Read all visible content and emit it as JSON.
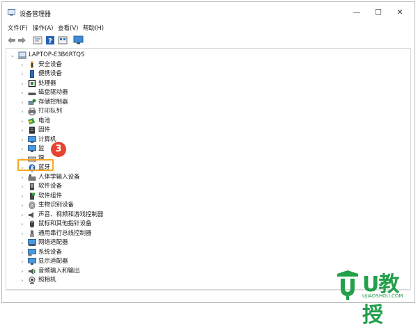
{
  "window": {
    "title": "设备管理器",
    "controls": {
      "minimize": "—",
      "maximize": "☐",
      "close": "✕"
    }
  },
  "menu": [
    {
      "label": "文件(F)"
    },
    {
      "label": "操作(A)"
    },
    {
      "label": "查看(V)"
    },
    {
      "label": "帮助(H)"
    }
  ],
  "toolbar": {
    "icons": [
      "back-arrow-icon",
      "forward-arrow-icon",
      "properties-icon",
      "help-icon",
      "view-icon",
      "monitor-icon"
    ]
  },
  "tree": {
    "root": {
      "label": "LAPTOP-E3B6RTQS",
      "expanded": true
    },
    "items": [
      {
        "label": "安全设备",
        "icon": "security-key-icon"
      },
      {
        "label": "便携设备",
        "icon": "portable-device-icon"
      },
      {
        "label": "处理器",
        "icon": "processor-icon"
      },
      {
        "label": "磁盘驱动器",
        "icon": "disk-drive-icon"
      },
      {
        "label": "存储控制器",
        "icon": "storage-controller-icon"
      },
      {
        "label": "打印队列",
        "icon": "printer-icon"
      },
      {
        "label": "电池",
        "icon": "battery-icon"
      },
      {
        "label": "固件",
        "icon": "firmware-icon"
      },
      {
        "label": "计算机",
        "icon": "computer-icon"
      },
      {
        "label": "监",
        "icon": "monitor-icon"
      },
      {
        "label": "键",
        "icon": "keyboard-icon"
      },
      {
        "label": "蓝牙",
        "icon": "bluetooth-icon"
      },
      {
        "label": "人体学输入设备",
        "icon": "hid-icon"
      },
      {
        "label": "软件设备",
        "icon": "software-device-icon"
      },
      {
        "label": "软件组件",
        "icon": "software-component-icon"
      },
      {
        "label": "生物识别设备",
        "icon": "biometric-icon"
      },
      {
        "label": "声音、视频和游戏控制器",
        "icon": "sound-icon"
      },
      {
        "label": "鼠标和其他指针设备",
        "icon": "mouse-icon"
      },
      {
        "label": "通用串行总线控制器",
        "icon": "usb-icon"
      },
      {
        "label": "网络适配器",
        "icon": "network-adapter-icon"
      },
      {
        "label": "系统设备",
        "icon": "system-device-icon"
      },
      {
        "label": "显示适配器",
        "icon": "display-adapter-icon"
      },
      {
        "label": "音频输入和输出",
        "icon": "audio-io-icon"
      },
      {
        "label": "照相机",
        "icon": "camera-icon"
      }
    ]
  },
  "annotation": {
    "step": "3",
    "color": "#e8432f",
    "highlight_color": "#f5a623"
  },
  "watermark": {
    "brand": "U教授",
    "url": "UJIAOSHOU.COM",
    "color": "#23a04b"
  }
}
